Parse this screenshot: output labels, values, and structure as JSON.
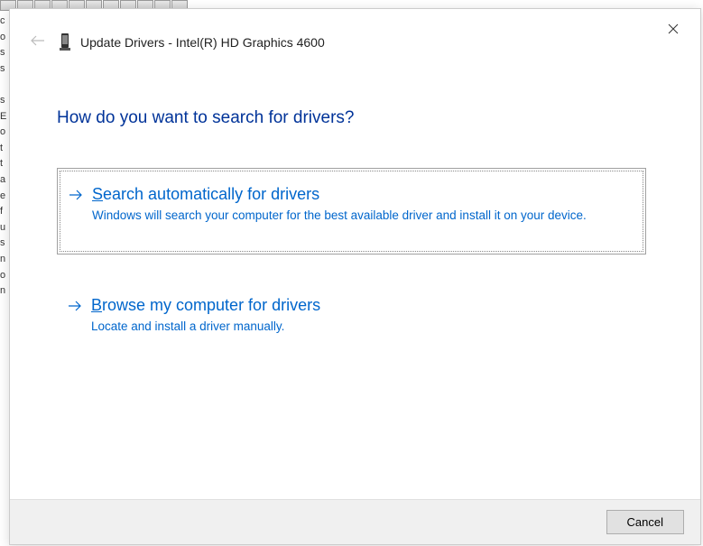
{
  "header": {
    "title": "Update Drivers - Intel(R) HD Graphics 4600"
  },
  "main": {
    "heading": "How do you want to search for drivers?"
  },
  "options": [
    {
      "mnemonic": "S",
      "title_rest": "earch automatically for drivers",
      "description": "Windows will search your computer for the best available driver and install it on your device.",
      "selected": true
    },
    {
      "mnemonic": "B",
      "title_rest": "rowse my computer for drivers",
      "description": "Locate and install a driver manually.",
      "selected": false
    }
  ],
  "footer": {
    "cancel_label": "Cancel"
  }
}
